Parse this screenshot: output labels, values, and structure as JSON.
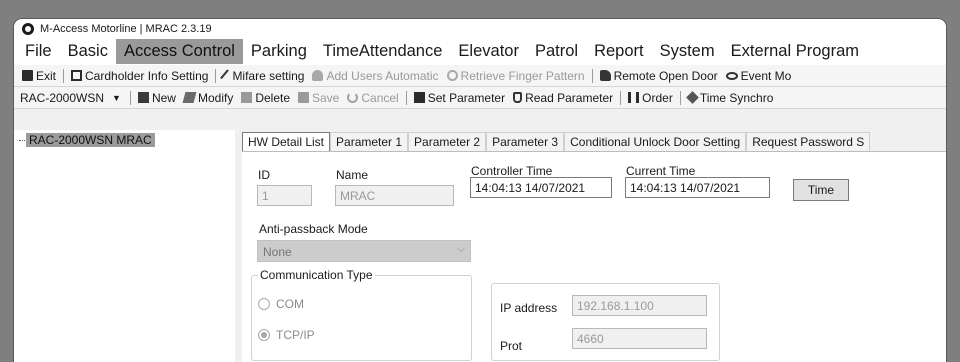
{
  "window": {
    "title": "M-Access Motorline | MRAC 2.3.19"
  },
  "menu": [
    {
      "label": "File"
    },
    {
      "label": "Basic"
    },
    {
      "label": "Access Control",
      "active": true
    },
    {
      "label": "Parking"
    },
    {
      "label": "TimeAttendance"
    },
    {
      "label": "Elevator"
    },
    {
      "label": "Patrol"
    },
    {
      "label": "Report"
    },
    {
      "label": "System"
    },
    {
      "label": "External Program"
    }
  ],
  "toolbar1": {
    "exit": "Exit",
    "cardholder": "Cardholder Info Setting",
    "mifare": "Mifare setting",
    "add_users": "Add Users Automatic",
    "retrieve_finger": "Retrieve Finger Pattern",
    "remote_open": "Remote Open Door",
    "event_monitor": "Event Mo"
  },
  "toolbar2": {
    "device": "RAC-2000WSN",
    "new": "New",
    "modify": "Modify",
    "delete": "Delete",
    "save": "Save",
    "cancel": "Cancel",
    "set_parameter": "Set Parameter",
    "read_parameter": "Read Parameter",
    "order": "Order",
    "time_sync": "Time Synchro"
  },
  "tree": {
    "node": "RAC-2000WSN  MRAC"
  },
  "tabs": [
    {
      "label": "HW Detail List",
      "active": true
    },
    {
      "label": "Parameter 1"
    },
    {
      "label": "Parameter 2"
    },
    {
      "label": "Parameter 3"
    },
    {
      "label": "Conditional Unlock Door Setting"
    },
    {
      "label": "Request Password S"
    }
  ],
  "detail": {
    "id_label": "ID",
    "id_value": "1",
    "name_label": "Name",
    "name_value": "MRAC",
    "controller_time_label": "Controller Time",
    "controller_time_value": "14:04:13 14/07/2021",
    "current_time_label": "Current Time",
    "current_time_value": "14:04:13 14/07/2021",
    "time_button": "Time",
    "antipassback_label": "Anti-passback Mode",
    "antipassback_value": "None",
    "comm_type_label": "Communication Type",
    "comm_options": [
      {
        "label": "COM",
        "checked": false
      },
      {
        "label": "TCP/IP",
        "checked": true
      }
    ],
    "ip_label": "IP address",
    "ip_value": "192.168.1.100",
    "port_label": "Prot",
    "port_value": "4660"
  }
}
